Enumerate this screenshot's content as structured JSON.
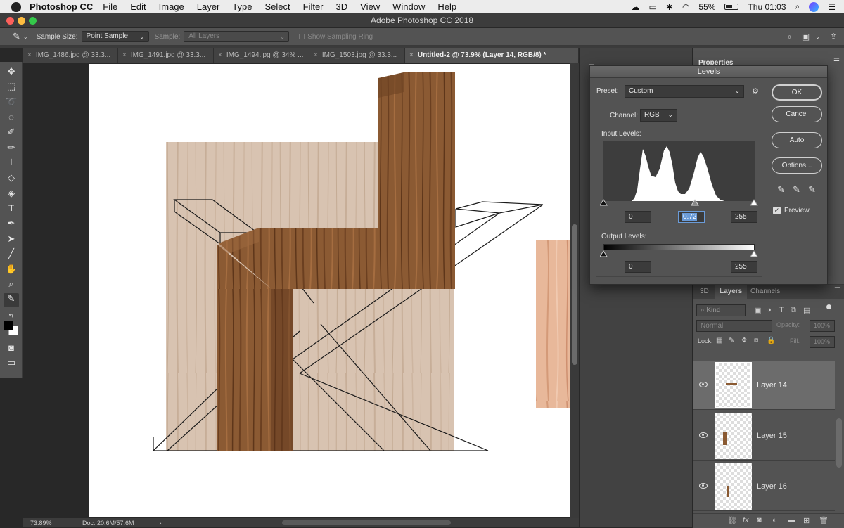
{
  "menubar": {
    "app": "Photoshop CC",
    "items": [
      "File",
      "Edit",
      "Image",
      "Layer",
      "Type",
      "Select",
      "Filter",
      "3D",
      "View",
      "Window",
      "Help"
    ],
    "battery": "55%",
    "clock": "Thu 01:03"
  },
  "window": {
    "title": "Adobe Photoshop CC 2018"
  },
  "options": {
    "sample_size_label": "Sample Size:",
    "sample_size_value": "Point Sample",
    "sample_label": "Sample:",
    "sample_value": "All Layers",
    "ring_label": "Show Sampling Ring"
  },
  "tabs": [
    {
      "label": "IMG_1486.jpg @ 33.3..."
    },
    {
      "label": "IMG_1491.jpg @ 33.3..."
    },
    {
      "label": "IMG_1494.jpg @ 34% ..."
    },
    {
      "label": "IMG_1503.jpg @ 33.3..."
    },
    {
      "label": "Untitled-2 @ 73.9% (Layer 14, RGB/8) *"
    }
  ],
  "status": {
    "zoom": "73.89%",
    "doc": "Doc: 20.6M/57.6M"
  },
  "levels": {
    "title": "Levels",
    "preset_label": "Preset:",
    "preset_value": "Custom",
    "channel_label": "Channel:",
    "channel_value": "RGB",
    "input_label": "Input Levels:",
    "input_black": "0",
    "input_gamma": "0.72",
    "input_white": "255",
    "output_label": "Output Levels:",
    "output_black": "0",
    "output_white": "255",
    "ok": "OK",
    "cancel": "Cancel",
    "auto": "Auto",
    "options": "Options...",
    "preview": "Preview"
  },
  "panels": {
    "properties_tab": "Properties",
    "tab_3d": "3D",
    "tab_layers": "Layers",
    "tab_channels": "Channels",
    "kind": "Kind",
    "blend": "Normal",
    "opacity_label": "Opacity:",
    "opacity_value": "100%",
    "lock_label": "Lock:",
    "fill_label": "Fill:",
    "fill_value": "100%",
    "layers": [
      {
        "name": "Layer 14"
      },
      {
        "name": "Layer 15"
      },
      {
        "name": "Layer 16"
      }
    ]
  },
  "colors": {
    "accent": "#6a9bd8",
    "panel": "#535353",
    "wood_dark": "#8a5a32",
    "wood_light": "#d9c3b0"
  }
}
